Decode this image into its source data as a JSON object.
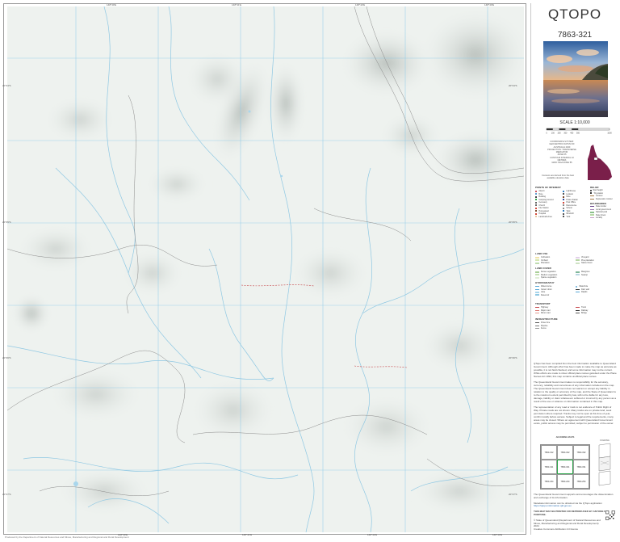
{
  "map": {
    "title": "QTOPO",
    "map_number": "7863-321",
    "scale": "SCALE 1:10,000",
    "scale_ticks": [
      "0",
      "100",
      "200",
      "300",
      "400",
      "500",
      "1000"
    ],
    "colors": {
      "terrain": "#eef2ef",
      "grid": "#89c9ea",
      "watercourse": "#8fc8e3",
      "contour": "#8a8a8a",
      "road": "#c6474b",
      "index_highlight": "#2ea84b",
      "locator_state": "#7a1f4a"
    },
    "edge_labels": {
      "top": [
        "148°40'E",
        "148°41'E",
        "148°42'E",
        "148°43'E"
      ],
      "bottom": [
        "148°40'E",
        "148°41'E",
        "148°42'E",
        "148°43'E"
      ],
      "left": [
        "20°44'S",
        "20°45'S",
        "20°46'S",
        "20°47'S"
      ],
      "right": [
        "20°44'S",
        "20°45'S",
        "20°46'S",
        "20°47'S"
      ]
    },
    "bottom_credit": "Produced by the Department of Natural Resources and Mines, Manufacturing and Regional and Rural Development"
  },
  "panel": {
    "datum_lines": [
      "COORDINATE SYSTEM: GEOCENTRIC DATUM OF AUSTRALIA 2020",
      "PROJECTION: TRANSVERSE MERCATOR",
      "ZONE 55",
      "CONTOUR INTERVAL 10 METRES",
      "GRID: MGA ZONE 55"
    ],
    "locator_note": "Contours are derived from the best available elevation data",
    "locator_state": "Queensland",
    "legend_title": "POINTS OF INTEREST",
    "legend_sections": [
      {
        "title": "POINTS OF INTEREST",
        "items": [
          "Airport",
          "Bore",
          "Building",
          "Camping Ground",
          "Cemetery",
          "Church",
          "Fire Station",
          "Homestead",
          "Hospital",
          "Landmark Area",
          "Lighthouse",
          "Lookout",
          "Mine",
          "Police Station",
          "Post Office",
          "Racecourse",
          "School",
          "Tank",
          "Windmill",
          "Yard"
        ]
      },
      {
        "title": "RELIEF",
        "items": [
          "Spot height",
          "Trig station",
          "Contour",
          "Depression contour"
        ]
      },
      {
        "title": "BOUNDARIES",
        "items": [
          "State border",
          "Local government",
          "National park",
          "State forest",
          "Locality"
        ]
      },
      {
        "title": "LAND USE",
        "items": [
          "Cultivation",
          "Orchard",
          "Plantation",
          "Vineyard",
          "Pine plantation",
          "Native forest"
        ]
      },
      {
        "title": "LAND COVER",
        "items": [
          "Dense vegetation",
          "Medium vegetation",
          "Sparse vegetation",
          "Mangrove",
          "Swamp"
        ]
      },
      {
        "title": "HYDROGRAPHY",
        "items": [
          "Watercourse",
          "Canal / drain",
          "Lake",
          "Reservoir",
          "Waterhole",
          "Dam wall",
          "Rapids"
        ]
      },
      {
        "title": "TRANSPORT",
        "items": [
          "Highway",
          "Major road",
          "Minor road",
          "Track",
          "Railway",
          "Bridge"
        ]
      },
      {
        "title": "INFRASTRUCTURE",
        "items": [
          "Power line",
          "Pipeline",
          "Fence"
        ]
      }
    ],
    "disclaimer": [
      "QTopo has been compiled from the best information available to Queensland Government. Although effort has been made to make the map as accurate as possible, it is not field checked, and some information may not be current. While efforts are made to show official place names gazetted under the Place Names Act 1994, this map contains unofficial place names.",
      "The Queensland Government takes no responsibility for the accuracy, currency, reliability and correctness of any information included on the map. The Queensland Government does not warrant or accept any liability in relation to the quality or accuracy of the map, and the State of Queensland is to the maximum extent permitted by law, will not be liable for any loss, damage, liability or claim whatsoever suffered or incurred by any person as a result of the use or reliance on information contained in this map.",
      "The representation of any road or track is not evidence of Public Right of Way. Private roads are not shown. Many tracks are on private land, seek permission where required. Tracks may not be open at this time of year, confirm locally before access. Subject to legal and fire requirements, many areas may be closed. Where an agreement with Queensland Government exists, public access may be permitted, subject to permission of the owner."
    ],
    "index_title": "ADJOINING MAPS",
    "index_cells": [
      "7863-312",
      "7863-322",
      "7863-332",
      "7863-311",
      "7863-321",
      "7863-331",
      "7863-234",
      "7863-244",
      "7863-254"
    ],
    "folding_title": "FOLDING",
    "footer": [
      "The Queensland Government supports and encourages the dissemination and exchange of its information.",
      "Metadata information can be obtained via the QTopo application",
      "https://qtopo.information.qld.gov.au",
      "THIS MAP MAY BE PRINTED OR REPRODUCED BY ANYONE FOR ANY PURPOSE.",
      "© State of Queensland (Department of Natural Resources and Mines, Manufacturing and Regional and Rural Development) 2024",
      "Creative Commons Attribution 4.0 licence"
    ]
  }
}
